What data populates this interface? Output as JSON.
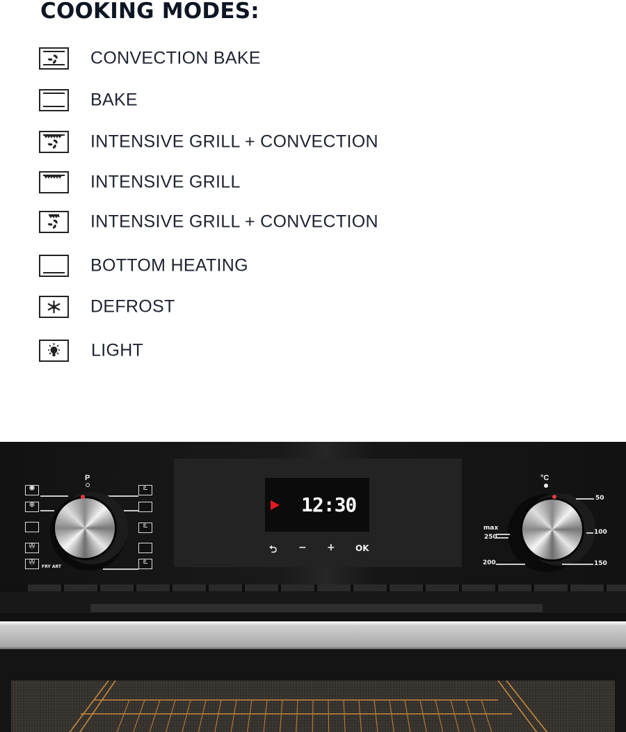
{
  "title": "COOKING MODES:",
  "modes": [
    {
      "icon": "convection-bake-icon",
      "label": "CONVECTION BAKE"
    },
    {
      "icon": "bake-icon",
      "label": "BAKE"
    },
    {
      "icon": "intensive-grill-convection-icon",
      "label": "INTENSIVE GRILL + CONVECTION"
    },
    {
      "icon": "intensive-grill-icon",
      "label": "INTENSIVE GRILL"
    },
    {
      "icon": "intensive-grill-convection-icon",
      "label": "INTENSIVE GRILL + CONVECTION"
    },
    {
      "icon": "bottom-heating-icon",
      "label": "BOTTOM HEATING"
    },
    {
      "icon": "defrost-icon",
      "label": "DEFROST"
    },
    {
      "icon": "light-icon",
      "label": "LIGHT"
    }
  ],
  "oven": {
    "mode_knob_label": "P",
    "fry_label": "FRY ART",
    "display_time": "12:30",
    "buttons": {
      "back": "⮌",
      "minus": "−",
      "plus": "+",
      "ok": "OK"
    },
    "temp_knob_label": "°C",
    "temp_marks": {
      "t50": "50",
      "t100": "100",
      "t150": "150",
      "t200": "200",
      "t250": "250",
      "tmax": "max"
    },
    "indicator_color": "#e4191d"
  }
}
